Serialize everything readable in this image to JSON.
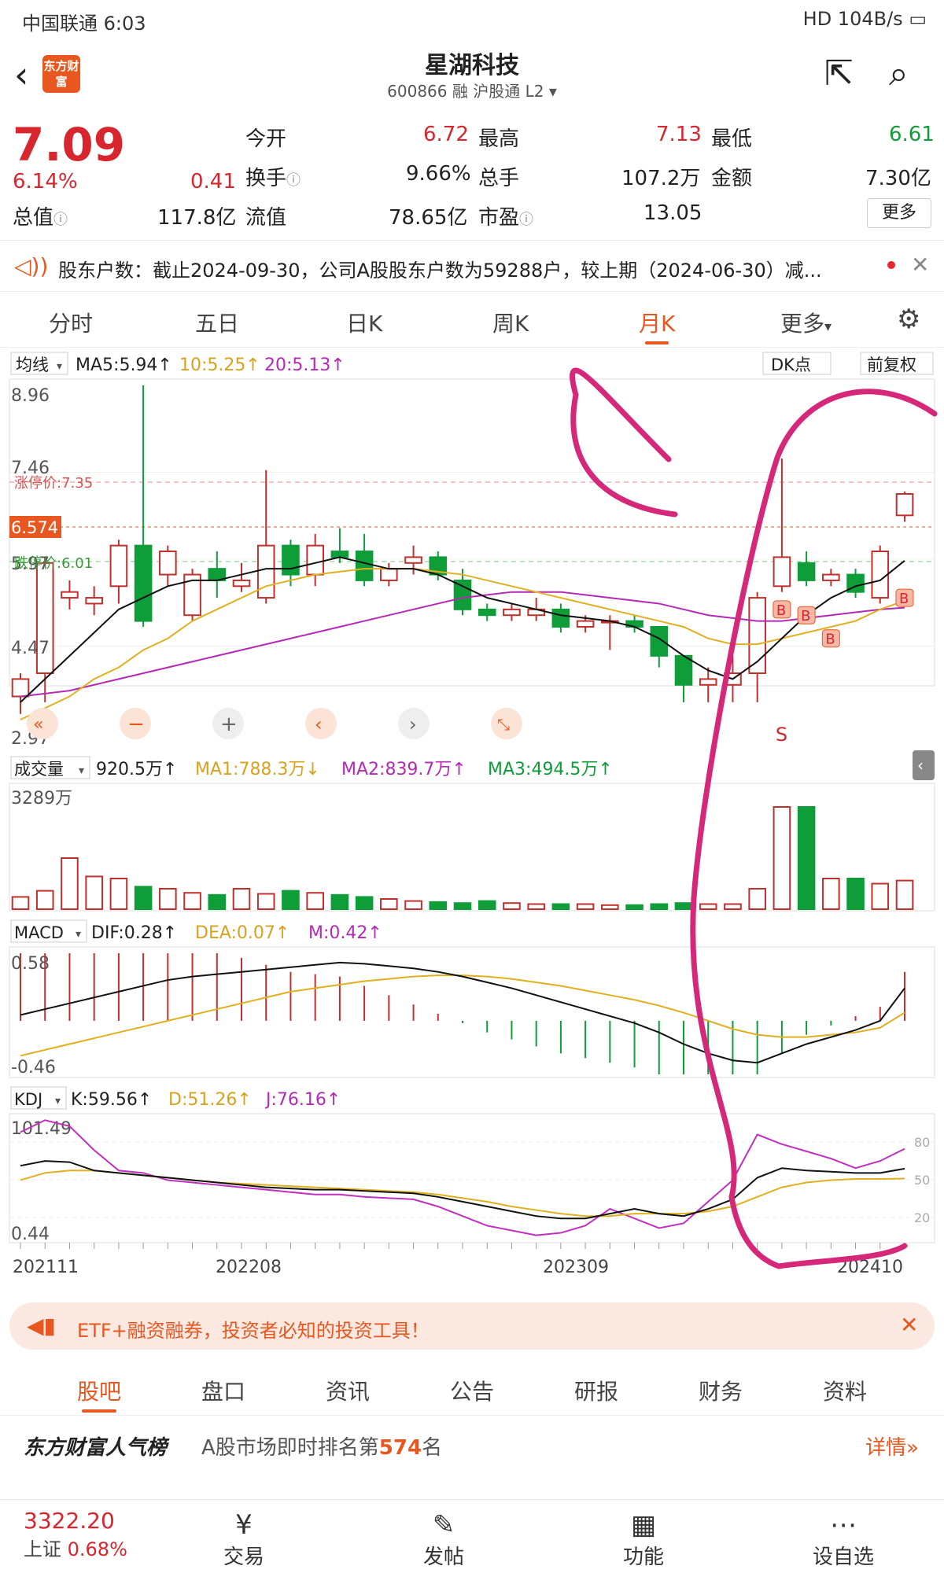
{
  "status": {
    "left": "中国联通 6:03",
    "right": "HD 104B/s"
  },
  "header": {
    "title": "星湖科技",
    "code": "600866",
    "tags": "融 沪股通 L2",
    "logo": "东方财富"
  },
  "quote": {
    "price": "7.09",
    "pct": "6.14%",
    "change": "0.41",
    "open_label": "今开",
    "open": "6.72",
    "high_label": "最高",
    "high": "7.13",
    "low_label": "最低",
    "low": "6.61",
    "turn_label": "换手",
    "turn": "9.66%",
    "vol_label": "总手",
    "vol": "107.2万",
    "amt_label": "金额",
    "amt": "7.30亿",
    "cap_label": "总值",
    "cap": "117.8亿",
    "float_label": "流值",
    "float": "78.65亿",
    "pe_label": "市盈",
    "pe": "13.05",
    "more": "更多"
  },
  "notice": {
    "text": "股东户数：截止2024-09-30，公司A股股东户数为59288户，较上期（2024-06-30）减..."
  },
  "tabs": [
    {
      "label": "分时"
    },
    {
      "label": "五日"
    },
    {
      "label": "日K"
    },
    {
      "label": "周K"
    },
    {
      "label": "月K"
    },
    {
      "label": "更多"
    }
  ],
  "ma_row": {
    "label": "均线",
    "ma5": "MA5:5.94↑",
    "ma10": "10:5.25↑",
    "ma20": "20:5.13↑",
    "dk": "DK点",
    "fq": "前复权"
  },
  "price_axis": {
    "top": "8.96",
    "t2": "7.46",
    "mid": "6.574",
    "t4": "5.97",
    "t5": "4.47",
    "bottom": "2.97",
    "limit_up": "涨停价:7.35",
    "limit_down": "跌停价:6.01"
  },
  "vol_row": {
    "label": "成交量",
    "v": "920.5万↑",
    "ma1": "MA1:788.3万↓",
    "ma2": "MA2:839.7万↑",
    "ma3": "MA3:494.5万↑",
    "top": "3289万"
  },
  "macd_row": {
    "label": "MACD",
    "dif": "DIF:0.28↑",
    "dea": "DEA:0.07↑",
    "m": "M:0.42↑",
    "top": "0.58",
    "bottom": "-0.46"
  },
  "kdj_row": {
    "label": "KDJ",
    "k": "K:59.56↑",
    "d": "D:51.26↑",
    "j": "J:76.16↑",
    "top": "101.49",
    "bottom": "0.44",
    "r80": "80",
    "r50": "50",
    "r20": "20"
  },
  "dates": [
    "202111",
    "202208",
    "202309",
    "202410"
  ],
  "signals": {
    "b": "B",
    "s": "S"
  },
  "banner": {
    "text": "ETF+融资融券，投资者必知的投资工具！"
  },
  "subtabs": [
    {
      "label": "股吧"
    },
    {
      "label": "盘口"
    },
    {
      "label": "资讯"
    },
    {
      "label": "公告"
    },
    {
      "label": "研报"
    },
    {
      "label": "财务"
    },
    {
      "label": "资料"
    }
  ],
  "rank": {
    "brand": "东方财富人气榜",
    "text": "A股市场即时排名第",
    "num": "574",
    "suffix": "名",
    "detail": "详情"
  },
  "bottom": {
    "index": "3322.20",
    "index_name": "上证",
    "index_pct": "0.68%",
    "trade": "交易",
    "post": "发帖",
    "func": "功能",
    "watch": "设自选"
  },
  "chart_data": {
    "type": "candlestick",
    "ylim": [
      2.97,
      8.96
    ],
    "candles": [
      [
        3.6,
        3.9,
        3.3,
        4.0
      ],
      [
        4.0,
        5.9,
        3.5,
        6.0
      ],
      [
        5.3,
        5.4,
        5.1,
        5.6
      ],
      [
        5.2,
        5.3,
        5.0,
        5.5
      ],
      [
        5.5,
        6.2,
        5.2,
        6.3
      ],
      [
        6.2,
        4.9,
        4.8,
        8.96
      ],
      [
        5.7,
        6.1,
        5.5,
        6.2
      ],
      [
        5.0,
        5.7,
        4.9,
        5.8
      ],
      [
        5.8,
        5.6,
        5.3,
        6.1
      ],
      [
        5.5,
        5.6,
        5.4,
        5.9
      ],
      [
        5.3,
        6.2,
        5.2,
        7.5
      ],
      [
        6.2,
        5.7,
        5.5,
        6.3
      ],
      [
        5.7,
        6.2,
        5.5,
        6.4
      ],
      [
        6.1,
        6.0,
        5.9,
        6.5
      ],
      [
        6.1,
        5.6,
        5.5,
        6.4
      ],
      [
        5.6,
        5.8,
        5.5,
        5.9
      ],
      [
        5.9,
        6.0,
        5.7,
        6.2
      ],
      [
        6.0,
        5.7,
        5.6,
        6.1
      ],
      [
        5.6,
        5.1,
        5.0,
        5.8
      ],
      [
        5.1,
        5.0,
        4.9,
        5.2
      ],
      [
        5.0,
        5.1,
        4.9,
        5.2
      ],
      [
        5.0,
        5.1,
        4.9,
        5.3
      ],
      [
        5.1,
        4.8,
        4.7,
        5.2
      ],
      [
        4.8,
        4.9,
        4.7,
        5.0
      ],
      [
        4.9,
        4.9,
        4.4,
        5.0
      ],
      [
        4.9,
        4.8,
        4.7,
        5.0
      ],
      [
        4.8,
        4.3,
        4.1,
        4.8
      ],
      [
        4.3,
        3.8,
        3.5,
        4.3
      ],
      [
        3.8,
        3.9,
        3.5,
        4.1
      ],
      [
        3.8,
        4.0,
        3.5,
        4.3
      ],
      [
        4.0,
        5.3,
        3.5,
        5.4
      ],
      [
        5.5,
        6.0,
        5.4,
        7.7
      ],
      [
        5.9,
        5.6,
        5.5,
        6.1
      ],
      [
        5.6,
        5.7,
        5.5,
        5.8
      ],
      [
        5.7,
        5.4,
        5.3,
        5.8
      ],
      [
        5.3,
        6.1,
        5.2,
        6.2
      ],
      [
        6.72,
        7.09,
        6.61,
        7.13
      ]
    ],
    "ma5": [
      3.5,
      3.9,
      4.3,
      4.7,
      5.1,
      5.3,
      5.5,
      5.6,
      5.6,
      5.7,
      5.8,
      5.8,
      5.9,
      6.0,
      5.9,
      5.8,
      5.8,
      5.7,
      5.5,
      5.3,
      5.2,
      5.1,
      5.0,
      4.95,
      4.9,
      4.8,
      4.6,
      4.3,
      4.05,
      3.9,
      4.2,
      4.6,
      5.0,
      5.3,
      5.5,
      5.6,
      5.94
    ],
    "ma10": [
      3.2,
      3.4,
      3.6,
      3.9,
      4.1,
      4.4,
      4.6,
      4.9,
      5.1,
      5.3,
      5.5,
      5.6,
      5.7,
      5.75,
      5.8,
      5.8,
      5.8,
      5.75,
      5.7,
      5.6,
      5.5,
      5.4,
      5.3,
      5.2,
      5.1,
      5.0,
      4.9,
      4.8,
      4.6,
      4.5,
      4.5,
      4.6,
      4.7,
      4.8,
      4.9,
      5.1,
      5.25
    ],
    "ma20": [
      3.6,
      3.65,
      3.7,
      3.8,
      3.9,
      4.0,
      4.1,
      4.2,
      4.3,
      4.4,
      4.5,
      4.6,
      4.7,
      4.8,
      4.9,
      5.0,
      5.1,
      5.2,
      5.3,
      5.35,
      5.4,
      5.4,
      5.4,
      5.35,
      5.3,
      5.25,
      5.2,
      5.1,
      5.0,
      4.95,
      4.9,
      4.9,
      4.95,
      5.0,
      5.05,
      5.1,
      5.13
    ],
    "volume": [
      0.12,
      0.18,
      0.5,
      0.32,
      0.3,
      0.22,
      0.2,
      0.16,
      0.14,
      0.2,
      0.15,
      0.18,
      0.16,
      0.14,
      0.12,
      0.1,
      0.08,
      0.07,
      0.06,
      0.08,
      0.06,
      0.05,
      0.05,
      0.05,
      0.04,
      0.04,
      0.05,
      0.06,
      0.05,
      0.05,
      0.2,
      1.0,
      1.0,
      0.3,
      0.3,
      0.25,
      0.28
    ],
    "macd_dif": [
      0.05,
      0.1,
      0.15,
      0.2,
      0.25,
      0.3,
      0.35,
      0.38,
      0.4,
      0.42,
      0.44,
      0.46,
      0.48,
      0.5,
      0.49,
      0.47,
      0.45,
      0.42,
      0.38,
      0.33,
      0.28,
      0.22,
      0.16,
      0.1,
      0.04,
      -0.02,
      -0.1,
      -0.2,
      -0.28,
      -0.34,
      -0.36,
      -0.28,
      -0.2,
      -0.14,
      -0.08,
      0.0,
      0.28
    ],
    "macd_dea": [
      -0.3,
      -0.25,
      -0.2,
      -0.15,
      -0.1,
      -0.05,
      0.0,
      0.05,
      0.1,
      0.15,
      0.2,
      0.25,
      0.28,
      0.31,
      0.34,
      0.36,
      0.38,
      0.39,
      0.39,
      0.38,
      0.36,
      0.33,
      0.3,
      0.26,
      0.22,
      0.18,
      0.13,
      0.07,
      0.0,
      -0.07,
      -0.12,
      -0.14,
      -0.14,
      -0.12,
      -0.1,
      -0.06,
      0.07
    ],
    "kdj_k": [
      62,
      66,
      65,
      58,
      56,
      54,
      52,
      50,
      48,
      46,
      44,
      43,
      42,
      42,
      41,
      40,
      39,
      36,
      32,
      28,
      24,
      20,
      18,
      18,
      22,
      26,
      22,
      20,
      26,
      34,
      52,
      60,
      58,
      57,
      56,
      56,
      59.56
    ],
    "kdj_d": [
      50,
      56,
      58,
      58,
      56,
      54,
      52,
      50,
      48,
      47,
      46,
      45,
      44,
      43,
      42,
      41,
      40,
      38,
      35,
      32,
      28,
      25,
      22,
      20,
      20,
      22,
      22,
      22,
      24,
      28,
      36,
      44,
      48,
      50,
      51,
      51,
      51.26
    ],
    "kdj_j": [
      90,
      100,
      95,
      75,
      58,
      56,
      50,
      48,
      46,
      44,
      42,
      40,
      38,
      38,
      36,
      35,
      34,
      28,
      20,
      12,
      8,
      4,
      6,
      12,
      26,
      18,
      10,
      14,
      32,
      50,
      88,
      80,
      74,
      68,
      60,
      66,
      76.16
    ]
  }
}
